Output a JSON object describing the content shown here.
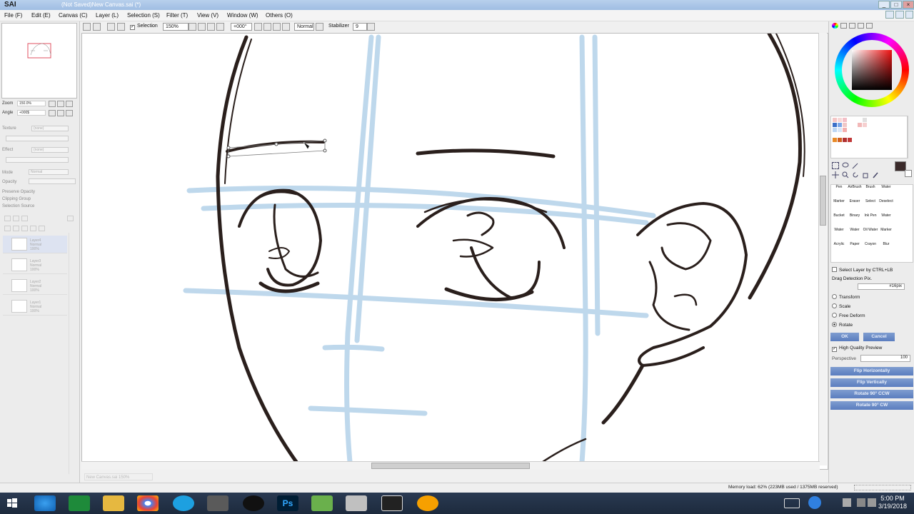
{
  "window": {
    "app_name": "SAI",
    "doc_title": "(Not Saved)New Canvas.sai (*)",
    "controls": [
      "_",
      "□",
      "×"
    ]
  },
  "menu": [
    "File (F)",
    "Edit (E)",
    "Canvas (C)",
    "Layer (L)",
    "Selection (S)",
    "Filter (T)",
    "View (V)",
    "Window (W)",
    "Others (O)"
  ],
  "toolbar": {
    "selection_label": "Selection",
    "zoom": "150%",
    "angle": "+000°",
    "blend": "Normal",
    "stabilizer_label": "Stabilizer",
    "stabilizer_value": "9"
  },
  "navigator": {
    "zoom_label": "Zoom",
    "zoom_value": "150.0%",
    "angle_label": "Angle",
    "angle_value": "+000$"
  },
  "layer_props": {
    "texture": "Texture",
    "texture_val": "(none)",
    "effect": "Effect",
    "effect_val": "(none)",
    "mode": "Mode",
    "mode_val": "Normal",
    "opacity": "Opacity",
    "preserve_opacity": "Preserve Opacity",
    "clipping_group": "Clipping Group",
    "selection_source": "Selection Source"
  },
  "layers": [
    {
      "name": "Layer4",
      "mode": "Normal",
      "opacity": "100%"
    },
    {
      "name": "Layer3",
      "mode": "Normal",
      "opacity": "100%"
    },
    {
      "name": "Layer2",
      "mode": "Normal",
      "opacity": "100%"
    },
    {
      "name": "Layer1",
      "mode": "Normal",
      "opacity": "100%"
    }
  ],
  "status_canvas_tab": "New Canvas.sai",
  "status_canvas_zoom": "150%",
  "brushes": [
    "Pen",
    "AirBrush",
    "Brush",
    "Water",
    "Marker",
    "Eraser",
    "Select",
    "Deselect",
    "Bucket",
    "Binary",
    "Ink Pen",
    "Water",
    "Water",
    "Water",
    "Oil Water",
    "Marker",
    "Acrylic",
    "Paper",
    "Crayon",
    "Blur"
  ],
  "transform": {
    "select_layer": "Select Layer by CTRL+LB",
    "drag_detection": "Drag Detection Pix.",
    "drag_value": "#16pix",
    "options": [
      "Transform",
      "Scale",
      "Free Deform",
      "Rotate"
    ],
    "selected": "Rotate",
    "ok": "OK",
    "cancel": "Cancel",
    "hq_preview": "High Quality Preview",
    "perspective": "Perspective",
    "perspective_value": "100",
    "flip_h": "Flip Horizontally",
    "flip_v": "Flip Vertically",
    "rot_ccw": "Rotate 90° CCW",
    "rot_cw": "Rotate 90° CW"
  },
  "status": {
    "memory": "Memory load: 62% (223MB used / 1375MB reserved)"
  },
  "taskbar": {
    "time": "5:00 PM",
    "date": "3/19/2018"
  },
  "colors": {
    "accent_blue": "#5a7dbf",
    "sketch_blue": "#a9cbe6",
    "ink": "#2a1f1c"
  }
}
